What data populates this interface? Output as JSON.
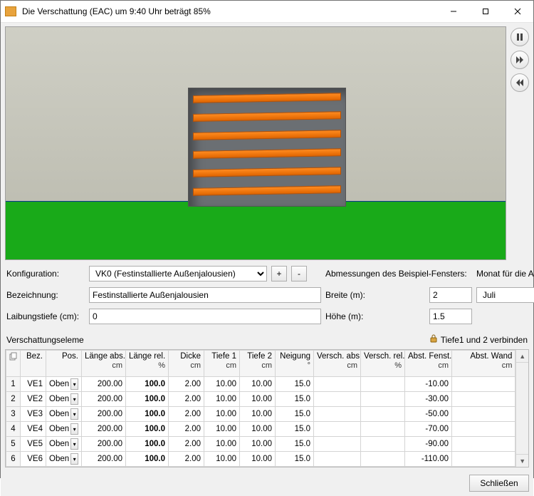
{
  "window": {
    "title": "Die Verschattung (EAC) um  9:40 Uhr beträgt  85%"
  },
  "form": {
    "config_label": "Konfiguration:",
    "config_value": "VK0 (Festinstallierte Außenjalousien)",
    "plus": "+",
    "minus": "-",
    "dims_label": "Abmessungen des Beispiel-Fensters:",
    "month_label": "Monat für die Anzeige",
    "name_label": "Bezeichnung:",
    "name_value": "Festinstallierte Außenjalousien",
    "width_label": "Breite (m):",
    "width_value": "2",
    "month_value": "Juli",
    "depth_label": "Laibungstiefe (cm):",
    "depth_value": "0",
    "height_label": "Höhe (m):",
    "height_value": "1.5"
  },
  "elements": {
    "header": "Verschattungseleme",
    "lock_text": "Tiefe1 und 2 verbinden",
    "cols": {
      "bez": {
        "t": "Bez.",
        "u": ""
      },
      "pos": {
        "t": "Pos.",
        "u": ""
      },
      "labs": {
        "t": "Länge abs.",
        "u": "cm"
      },
      "lrel": {
        "t": "Länge rel.",
        "u": "%"
      },
      "dick": {
        "t": "Dicke",
        "u": "cm"
      },
      "t1": {
        "t": "Tiefe 1",
        "u": "cm"
      },
      "t2": {
        "t": "Tiefe 2",
        "u": "cm"
      },
      "neig": {
        "t": "Neigung",
        "u": "°"
      },
      "vabs": {
        "t": "Versch. abs.",
        "u": "cm"
      },
      "vrel": {
        "t": "Versch. rel.",
        "u": "%"
      },
      "af": {
        "t": "Abst. Fenst.",
        "u": "cm"
      },
      "aw": {
        "t": "Abst. Wand",
        "u": "cm"
      }
    },
    "rows": [
      {
        "n": "1",
        "bez": "VE1",
        "pos": "Oben",
        "labs": "200.00",
        "lrel": "100.0",
        "dick": "2.00",
        "t1": "10.00",
        "t2": "10.00",
        "neig": "15.0",
        "vabs": "",
        "vrel": "",
        "af": "-10.00",
        "aw": ""
      },
      {
        "n": "2",
        "bez": "VE2",
        "pos": "Oben",
        "labs": "200.00",
        "lrel": "100.0",
        "dick": "2.00",
        "t1": "10.00",
        "t2": "10.00",
        "neig": "15.0",
        "vabs": "",
        "vrel": "",
        "af": "-30.00",
        "aw": ""
      },
      {
        "n": "3",
        "bez": "VE3",
        "pos": "Oben",
        "labs": "200.00",
        "lrel": "100.0",
        "dick": "2.00",
        "t1": "10.00",
        "t2": "10.00",
        "neig": "15.0",
        "vabs": "",
        "vrel": "",
        "af": "-50.00",
        "aw": ""
      },
      {
        "n": "4",
        "bez": "VE4",
        "pos": "Oben",
        "labs": "200.00",
        "lrel": "100.0",
        "dick": "2.00",
        "t1": "10.00",
        "t2": "10.00",
        "neig": "15.0",
        "vabs": "",
        "vrel": "",
        "af": "-70.00",
        "aw": ""
      },
      {
        "n": "5",
        "bez": "VE5",
        "pos": "Oben",
        "labs": "200.00",
        "lrel": "100.0",
        "dick": "2.00",
        "t1": "10.00",
        "t2": "10.00",
        "neig": "15.0",
        "vabs": "",
        "vrel": "",
        "af": "-90.00",
        "aw": ""
      },
      {
        "n": "6",
        "bez": "VE6",
        "pos": "Oben",
        "labs": "200.00",
        "lrel": "100.0",
        "dick": "2.00",
        "t1": "10.00",
        "t2": "10.00",
        "neig": "15.0",
        "vabs": "",
        "vrel": "",
        "af": "-110.00",
        "aw": ""
      }
    ]
  },
  "footer": {
    "close": "Schließen"
  }
}
